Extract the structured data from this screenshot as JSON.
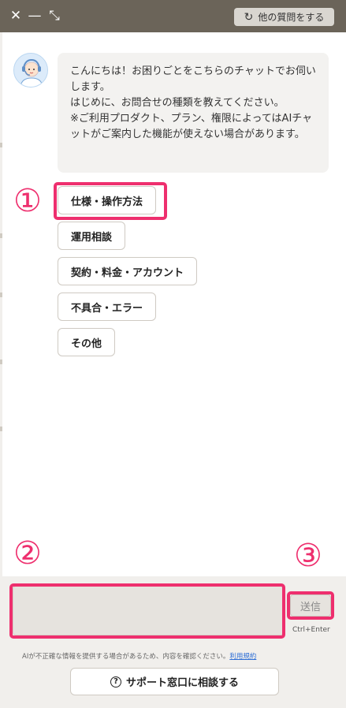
{
  "header": {
    "close_icon": "✕",
    "minimize_icon": "—",
    "shrink_icon": "⤡",
    "refresh_icon": "↻",
    "other_question_label": "他の質問をする"
  },
  "chat": {
    "bot_message": [
      "こんにちは！お困りごとをこちらのチャットでお伺いします。",
      "はじめに、お問合せの種類を教えてください。",
      "※ご利用プロダクト、プラン、権限によってはAIチャットがご案内した機能が使えない場合があります。"
    ],
    "options": [
      "仕様・操作方法",
      "運用相談",
      "契約・料金・アカウント",
      "不具合・エラー",
      "その他"
    ]
  },
  "annotations": {
    "marker1": "①",
    "marker2": "②",
    "marker3": "③",
    "color": "#ee2f6e"
  },
  "footer": {
    "input_value": "",
    "send_label": "送信",
    "shortcut_hint": "Ctrl+Enter",
    "disclaimer": "AIが不正確な情報を提供する場合があるため、内容を確認ください。",
    "terms_link": "利用規約",
    "support_label": "サポート窓口に相談する",
    "support_icon": "?"
  }
}
